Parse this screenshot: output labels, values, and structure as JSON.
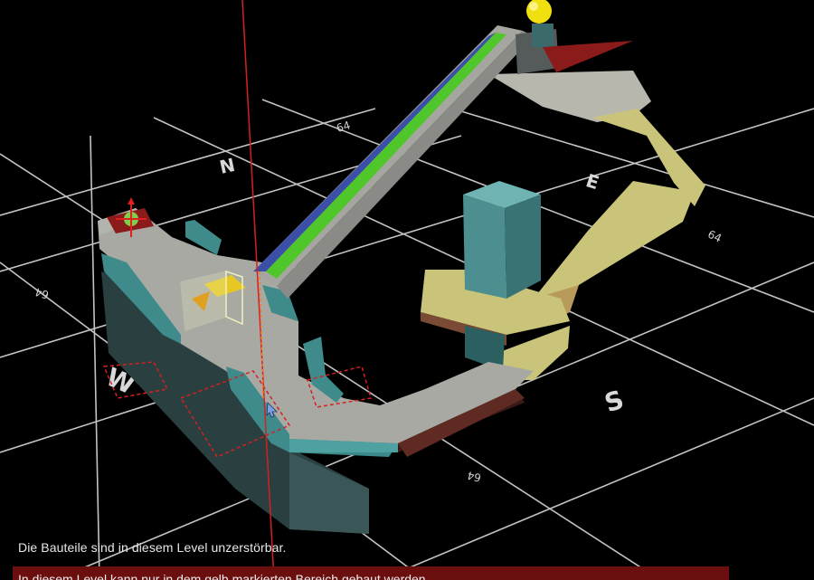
{
  "compass": {
    "north": "N",
    "east": "E",
    "south": "S",
    "west": "W"
  },
  "grid_labels": {
    "top": "64",
    "right": "64",
    "bottom": "64",
    "left": "64"
  },
  "status": {
    "info": "Die Bauteile sind in diesem Level unzerstörbar.",
    "hint": "In diesem Level kann nur in dem gelb markierten Bereich gebaut werden."
  },
  "colors": {
    "background": "#000000",
    "hint_bar": "#6b0e0e",
    "ramp_green": "#4fc72a",
    "ramp_blue": "#3b4fa8",
    "floor_grey": "#a9a9a4",
    "wall_teal": "#3f8b8b",
    "build_zone_yellow": "#c9c47a",
    "goal_sphere": "#f0e010",
    "axis_red": "#d42020"
  },
  "icons": [
    "start-marker-icon",
    "goal-sphere-icon",
    "selection-box-icon",
    "mouse-cursor-icon"
  ]
}
